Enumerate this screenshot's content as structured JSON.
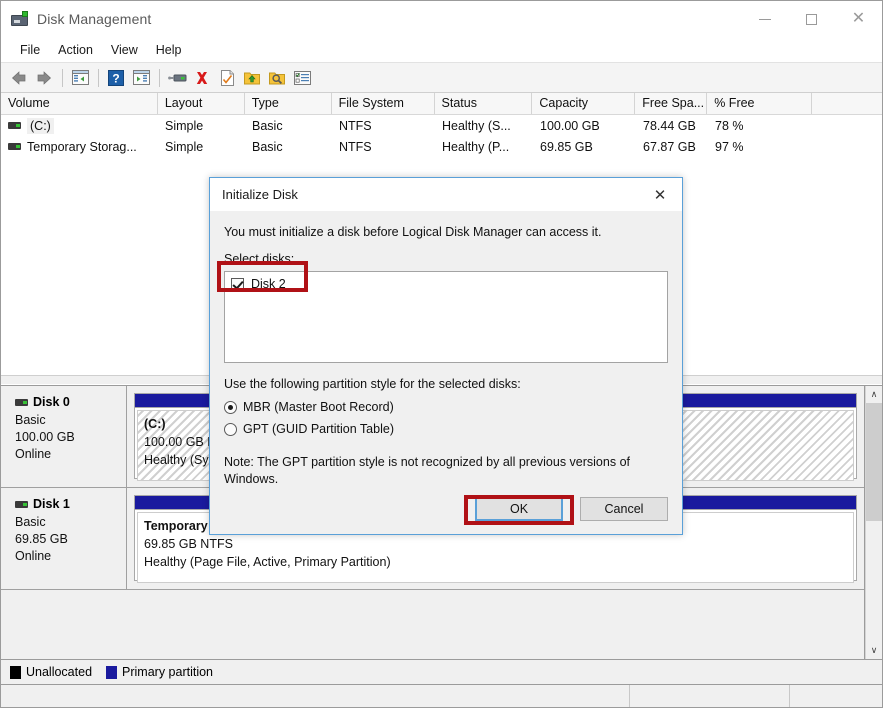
{
  "window": {
    "title": "Disk Management",
    "icon": "disk-management-icon",
    "controls": {
      "minimize": "—",
      "maximize": "□",
      "close": "✕"
    }
  },
  "menubar": {
    "items": [
      {
        "label": "File"
      },
      {
        "label": "Action"
      },
      {
        "label": "View"
      },
      {
        "label": "Help"
      }
    ]
  },
  "toolbar": {
    "buttons": [
      {
        "name": "back-icon",
        "tooltip": "Back"
      },
      {
        "name": "forward-icon",
        "tooltip": "Forward"
      },
      {
        "name": "show-hide-console-tree-icon",
        "tooltip": "Show/Hide Console Tree"
      },
      {
        "name": "help-icon",
        "tooltip": "Help"
      },
      {
        "name": "show-hide-action-pane-icon",
        "tooltip": "Show/Hide Action Pane"
      },
      {
        "name": "rescan-disks-icon",
        "tooltip": "Rescan Disks"
      },
      {
        "name": "delete-icon",
        "tooltip": "Delete"
      },
      {
        "name": "properties-icon",
        "tooltip": "Properties"
      },
      {
        "name": "export-list-icon",
        "tooltip": "Export List"
      },
      {
        "name": "search-folder-icon",
        "tooltip": "Search"
      },
      {
        "name": "show-details-icon",
        "tooltip": "Show Details"
      }
    ]
  },
  "volume_list": {
    "columns": [
      {
        "label": "Volume",
        "width": 157
      },
      {
        "label": "Layout",
        "width": 87
      },
      {
        "label": "Type",
        "width": 87
      },
      {
        "label": "File System",
        "width": 103
      },
      {
        "label": "Status",
        "width": 98
      },
      {
        "label": "Capacity",
        "width": 103
      },
      {
        "label": "Free Spa...",
        "width": 72
      },
      {
        "label": "% Free",
        "width": 105
      },
      {
        "label": "",
        "width": 70
      }
    ],
    "rows": [
      {
        "icon": "volume-icon",
        "selected": true,
        "cells": [
          "(C:)",
          "Simple",
          "Basic",
          "NTFS",
          "Healthy (S...",
          "100.00 GB",
          "78.44 GB",
          "78 %",
          ""
        ]
      },
      {
        "icon": "volume-icon",
        "selected": false,
        "cells": [
          "Temporary Storag...",
          "Simple",
          "Basic",
          "NTFS",
          "Healthy (P...",
          "69.85 GB",
          "67.87 GB",
          "97 %",
          ""
        ]
      }
    ]
  },
  "disk_pane": {
    "disks": [
      {
        "name": "Disk 0",
        "type": "Basic",
        "capacity": "100.00 GB",
        "status": "Online",
        "partition": {
          "label": "(C:)",
          "size_fs": "100.00 GB N",
          "health": "Healthy (Sys",
          "style": "hatched",
          "bar_color": "#1a1a9e"
        }
      },
      {
        "name": "Disk 1",
        "type": "Basic",
        "capacity": "69.85 GB",
        "status": "Online",
        "partition": {
          "label": "Temporary Storage 0  (Z:)",
          "size_fs": "69.85 GB NTFS",
          "health": "Healthy (Page File, Active, Primary Partition)",
          "style": "plain",
          "bar_color": "#1a1a9e"
        }
      }
    ],
    "scrollbar": {
      "up_arrow": "∧",
      "down_arrow": "∨"
    }
  },
  "legend": {
    "items": [
      {
        "label": "Unallocated",
        "color": "#000000"
      },
      {
        "label": "Primary partition",
        "color": "#1a1a9e"
      }
    ]
  },
  "statusbar": {
    "cells": [
      "",
      "",
      ""
    ]
  },
  "dialog": {
    "title": "Initialize Disk",
    "close_icon": "✕",
    "intro": "You must initialize a disk before Logical Disk Manager can access it.",
    "select_disks_label": "Select disks:",
    "disks": [
      {
        "label": "Disk 2",
        "checked": true
      }
    ],
    "partition_style_label": "Use the following partition style for the selected disks:",
    "options": [
      {
        "label": "MBR (Master Boot Record)",
        "selected": true
      },
      {
        "label": "GPT (GUID Partition Table)",
        "selected": false
      }
    ],
    "note": "Note: The GPT partition style is not recognized by all previous versions of Windows.",
    "buttons": {
      "ok": "OK",
      "cancel": "Cancel"
    }
  },
  "annotations": {
    "highlight_color": "#b01116",
    "boxes": [
      "disk-2-checkbox-highlight",
      "ok-button-highlight"
    ]
  }
}
